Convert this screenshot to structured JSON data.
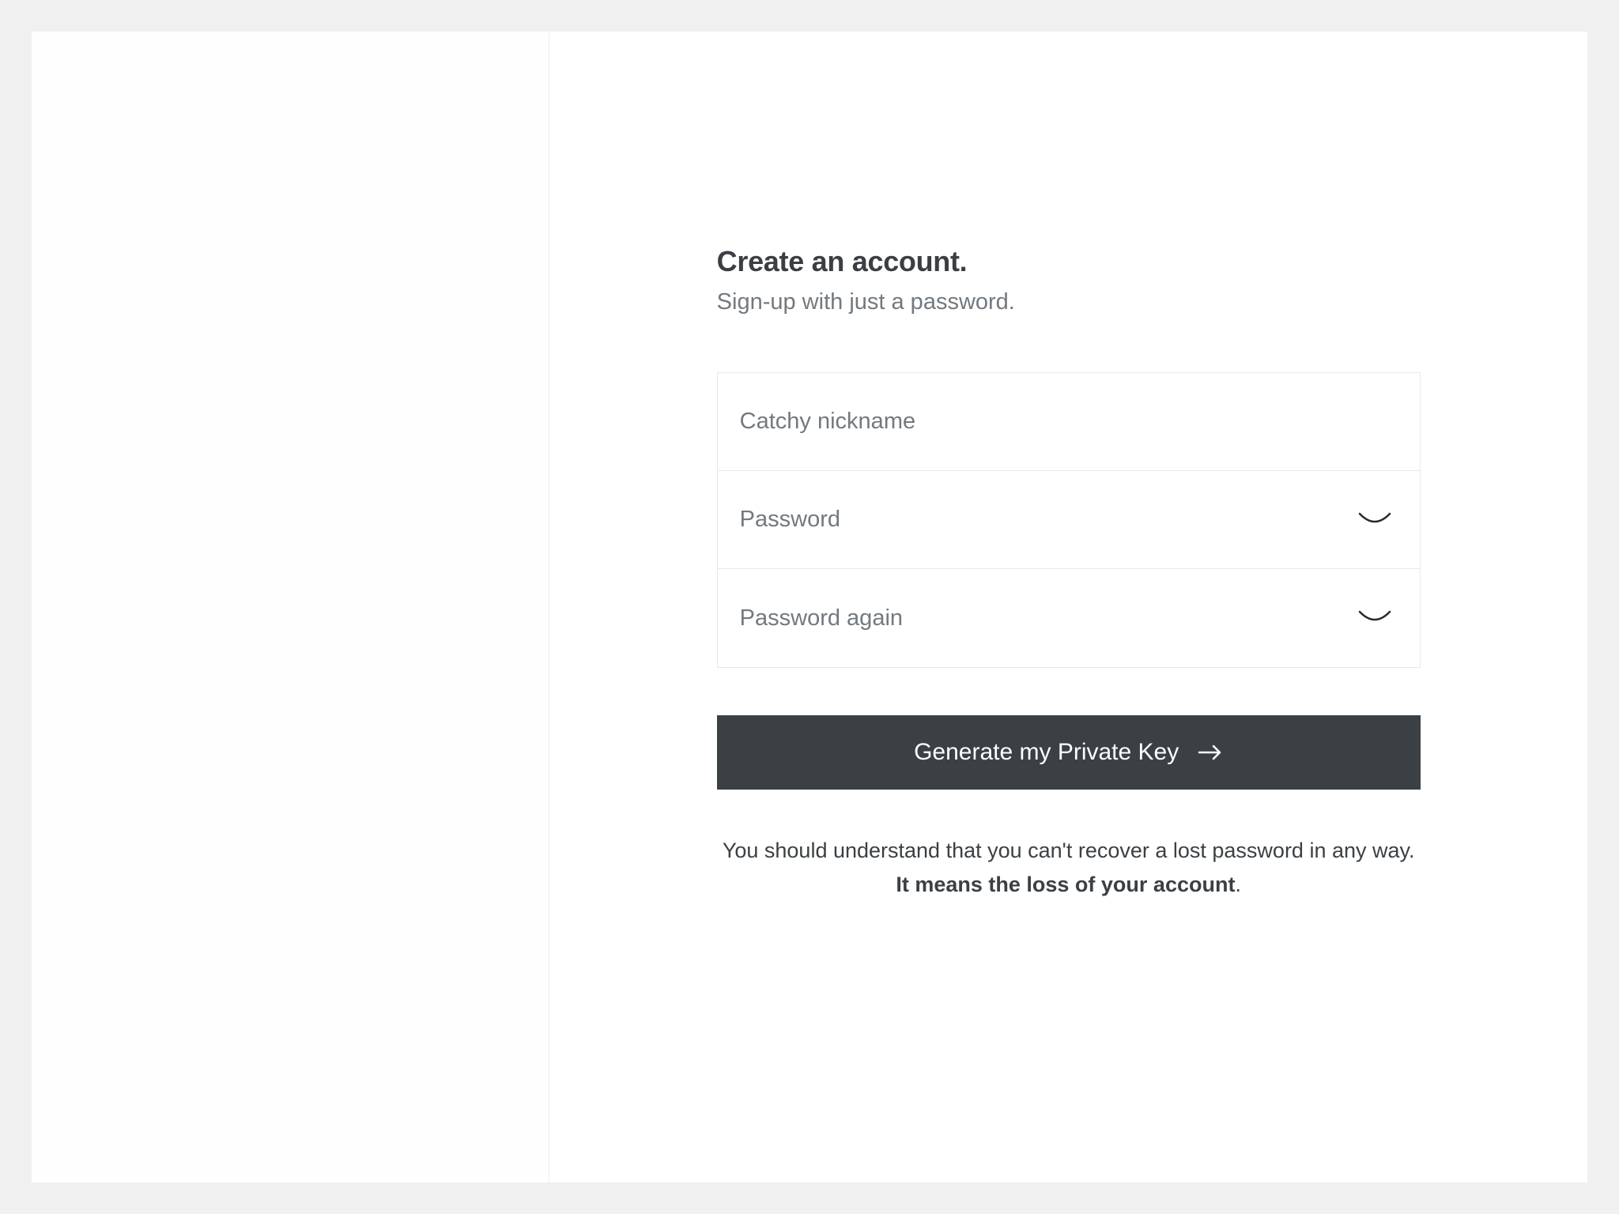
{
  "header": {
    "title": "Create an account.",
    "subtitle": "Sign-up with just a password."
  },
  "form": {
    "nickname_placeholder": "Catchy nickname",
    "password_placeholder": "Password",
    "password_again_placeholder": "Password again",
    "submit_label": "Generate my Private Key"
  },
  "disclaimer": {
    "text_before": "You should understand that you can't recover a lost password in any way. ",
    "text_strong": "It means the loss of your account",
    "text_after": "."
  }
}
